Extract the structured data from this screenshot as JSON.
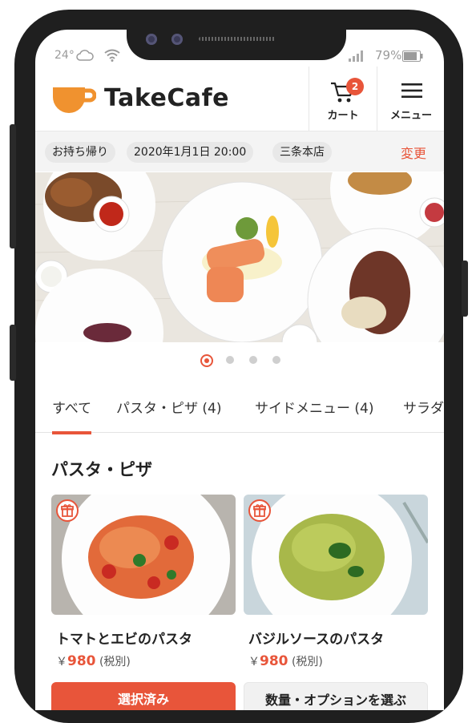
{
  "status": {
    "temperature": "24°",
    "battery": "79%"
  },
  "header": {
    "brand": "TakeCafe",
    "cart_label": "カート",
    "cart_count": "2",
    "menu_label": "メニュー"
  },
  "order": {
    "mode": "お持ち帰り",
    "datetime": "2020年1月1日 20:00",
    "store": "三条本店",
    "change_label": "変更"
  },
  "carousel": {
    "count": 4,
    "active": 0
  },
  "tabs": [
    {
      "label": "すべて",
      "active": true
    },
    {
      "label": "パスタ・ピザ (4)",
      "active": false
    },
    {
      "label": "サイドメニュー (4)",
      "active": false
    },
    {
      "label": "サラダ",
      "active": false
    }
  ],
  "section": {
    "title": "パスタ・ピザ"
  },
  "products": [
    {
      "name": "トマトとエビのパスタ",
      "currency": "￥",
      "price": "980",
      "tax_note": "(税別)",
      "button": "選択済み",
      "selected": true
    },
    {
      "name": "バジルソースのパスタ",
      "currency": "￥",
      "price": "980",
      "tax_note": "(税別)",
      "button": "数量・オプションを選ぶ",
      "selected": false
    }
  ],
  "colors": {
    "accent": "#e8553a",
    "text": "#222222"
  },
  "icons": [
    "cloud-icon",
    "wifi-icon",
    "signal-icon",
    "battery-icon",
    "cup-logo-icon",
    "cart-icon",
    "hamburger-menu-icon",
    "gift-icon"
  ]
}
